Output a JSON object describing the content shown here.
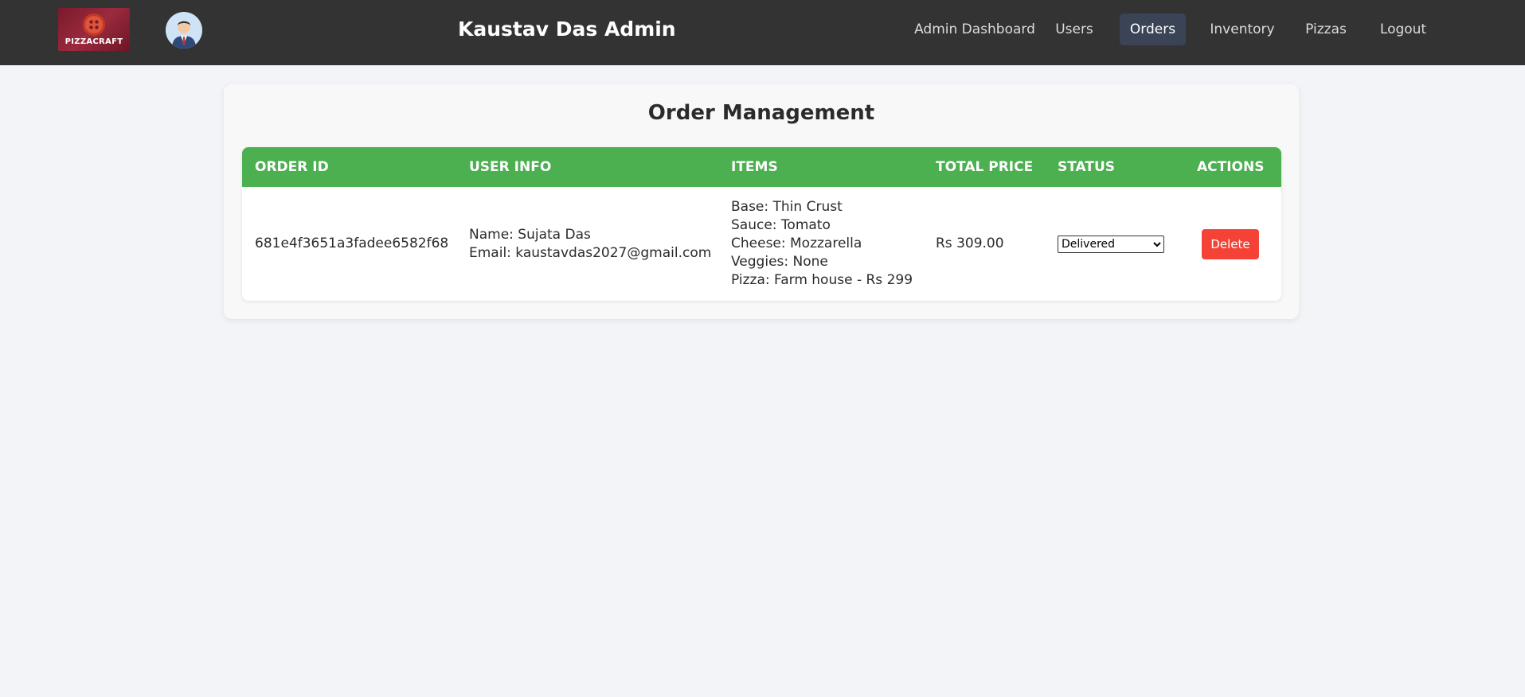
{
  "header": {
    "logo_text": "PIZZACRAFT",
    "title": "Kaustav Das Admin",
    "nav": [
      {
        "label": "Admin Dashboard",
        "active": false
      },
      {
        "label": "Users",
        "active": false
      },
      {
        "label": "Orders",
        "active": true
      },
      {
        "label": "Inventory",
        "active": false
      },
      {
        "label": "Pizzas",
        "active": false
      },
      {
        "label": "Logout",
        "active": false
      }
    ]
  },
  "main": {
    "title": "Order Management",
    "columns": [
      "ORDER ID",
      "USER INFO",
      "ITEMS",
      "TOTAL PRICE",
      "STATUS",
      "ACTIONS"
    ],
    "orders": [
      {
        "order_id": "681e4f3651a3fadee6582f68",
        "user_name": "Name: Sujata Das",
        "user_email": "Email: kaustavdas2027@gmail.com",
        "items": [
          "Base: Thin Crust",
          "Sauce: Tomato",
          "Cheese: Mozzarella",
          "Veggies: None",
          "Pizza: Farm house - Rs 299"
        ],
        "total_price": "Rs 309.00",
        "status": "Delivered",
        "delete_label": "Delete"
      }
    ]
  },
  "colors": {
    "navbar": "#333333",
    "table_header": "#4caf50",
    "delete_button": "#f44336",
    "active_nav": "#3b4457",
    "page_bg": "#f3f4f8"
  },
  "icons": {
    "logo": "pizza-logo-icon",
    "avatar": "admin-avatar-icon",
    "status_dropdown": "chevron-down-icon"
  }
}
